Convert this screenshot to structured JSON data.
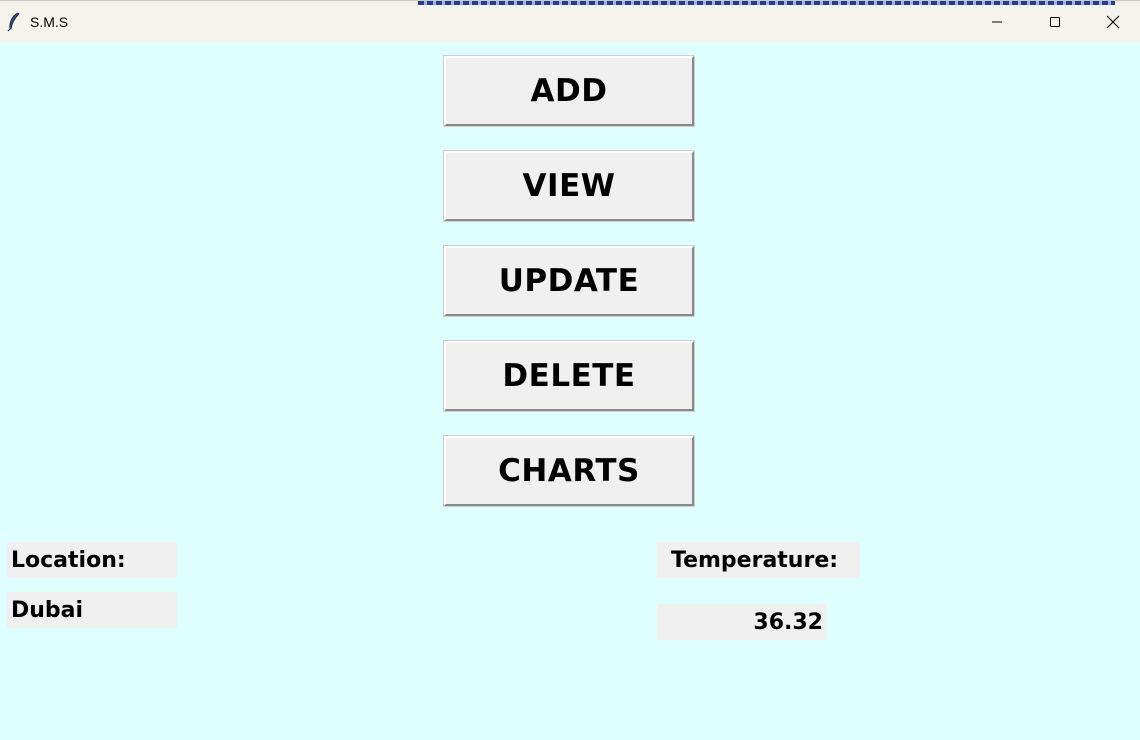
{
  "window": {
    "title": "S.M.S",
    "app_icon": "feather-icon",
    "controls": [
      "minimize-icon",
      "maximize-icon",
      "close-icon"
    ]
  },
  "colors": {
    "client_background": "#dfffff",
    "button_face": "#f0f0f0",
    "titlebar": "#f5f3ee"
  },
  "menu": {
    "add_label": "ADD",
    "view_label": "VIEW",
    "update_label": "UPDATE",
    "delete_label": "DELETE",
    "charts_label": "CHARTS"
  },
  "info": {
    "location_label": "Location:",
    "location_value": "Dubai",
    "temperature_label": "Temperature:",
    "temperature_value": "36.32"
  }
}
